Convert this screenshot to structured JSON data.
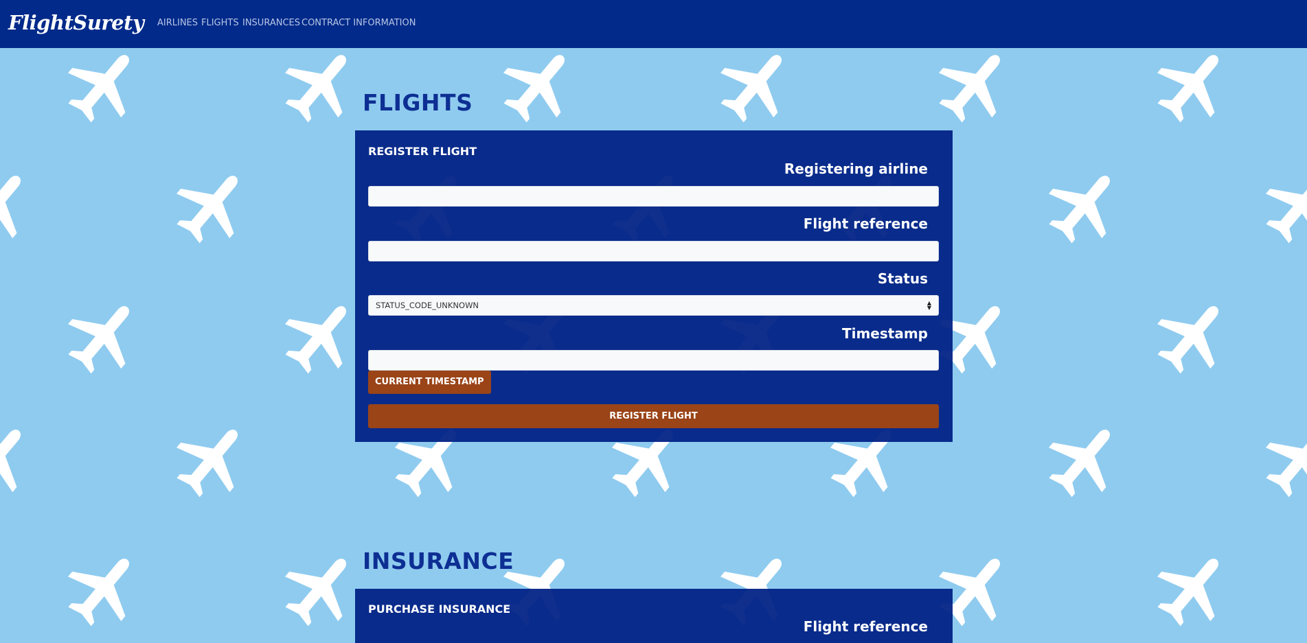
{
  "brand": "FlightSurety",
  "nav": {
    "items": [
      {
        "label": "AIRLINES"
      },
      {
        "label": "FLIGHTS"
      },
      {
        "label": "INSURANCES"
      },
      {
        "label": "CONTRACT INFORMATION"
      }
    ]
  },
  "flights": {
    "title": "FLIGHTS",
    "form_title": "REGISTER FLIGHT",
    "airline_label": "Registering airline",
    "airline_value": "",
    "flight_ref_label": "Flight reference",
    "flight_ref_value": "",
    "status_label": "Status",
    "status_selected": "STATUS_CODE_UNKNOWN",
    "timestamp_label": "Timestamp",
    "timestamp_value": "",
    "current_timestamp_button": "CURRENT TIMESTAMP",
    "register_button": "REGISTER FLIGHT"
  },
  "insurance": {
    "title": "INSURANCE",
    "form_title": "PURCHASE INSURANCE",
    "flight_ref_label": "Flight reference"
  },
  "colors": {
    "navbar": "#012a8a",
    "background": "#8fcbef",
    "panel": "#012185",
    "accent_button": "#9a4418",
    "heading": "#0d2f93"
  },
  "background_icon": "airplane-icon"
}
